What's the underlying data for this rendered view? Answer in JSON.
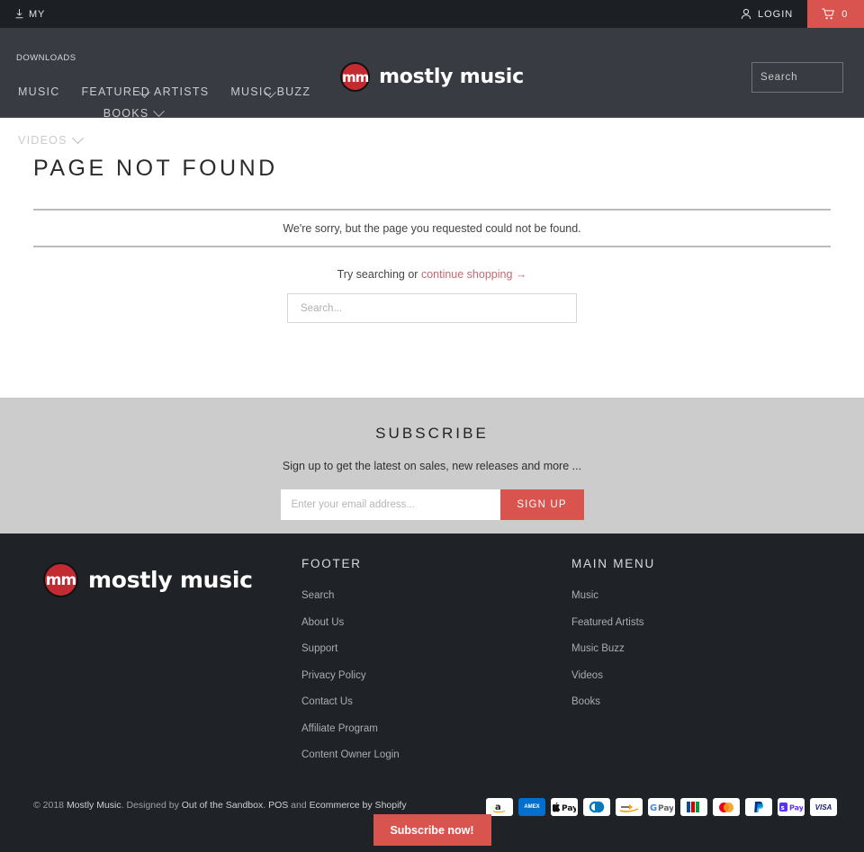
{
  "topbar": {
    "left_label": "MY",
    "left_icon": "download-icon",
    "login_label": "LOGIN",
    "login_icon": "user-icon",
    "cart_icon": "cart-icon",
    "cart_count": "0",
    "cart_color": "#d9534f"
  },
  "header": {
    "logo_mark": "mm",
    "logo_text": "mostly music",
    "search_placeholder": "Search",
    "search_value": "",
    "search_icon": "search-icon",
    "nav": [
      {
        "label": "MUSIC",
        "badge": "DOWNLOADS",
        "caret": false
      },
      {
        "label": "FEATURED ARTISTS",
        "badge": "",
        "caret": true,
        "caret_below": true
      },
      {
        "label": "MUSIC BUZZ",
        "badge": "",
        "caret": true,
        "caret_below": true
      },
      {
        "label": "VIDEOS",
        "badge": "",
        "caret": true,
        "caret_below": false
      },
      {
        "label": "BOOKS",
        "badge": "",
        "caret": true,
        "caret_below": false
      }
    ]
  },
  "main": {
    "title": "PAGE NOT FOUND",
    "message": "We're sorry, but the page you requested could not be found.",
    "try_prefix": "Try searching or ",
    "continue_link": "continue shopping →",
    "continue_link_color": "#c26a72",
    "search_placeholder": "Search...",
    "search_value": ""
  },
  "subscribe": {
    "title": "SUBSCRIBE",
    "description": "Sign up to get the latest on sales, new releases and more ...",
    "email_placeholder": "Enter your email address...",
    "email_value": "",
    "button_label": "SIGN UP",
    "background": "#cccccc",
    "button_color": "#d9534f"
  },
  "footer": {
    "logo_mark": "mm",
    "logo_text": "mostly music",
    "columns": [
      {
        "title": "FOOTER",
        "links": [
          "Search",
          "About Us",
          "Support",
          "Privacy Policy",
          "Contact Us",
          "Affiliate Program",
          "Content Owner Login"
        ]
      },
      {
        "title": "MAIN MENU",
        "links": [
          "Music",
          "Featured Artists",
          "Music Buzz",
          "Videos",
          "Books"
        ]
      }
    ],
    "copyright": {
      "prefix": "© 2018 ",
      "brand": "Mostly Music",
      "mid": ". Designed by ",
      "designer": "Out of the Sandbox",
      "dot": ". ",
      "pos": "POS",
      "and": " and ",
      "ecommerce": "Ecommerce by Shopify"
    },
    "payments": [
      "amazon",
      "amex",
      "apple-pay",
      "diners-club",
      "discover",
      "google-pay",
      "jcb",
      "mastercard",
      "paypal",
      "shop-pay",
      "visa"
    ],
    "subscribe_now_label": "Subscribe now!",
    "subscribe_now_color": "#d9534f"
  }
}
